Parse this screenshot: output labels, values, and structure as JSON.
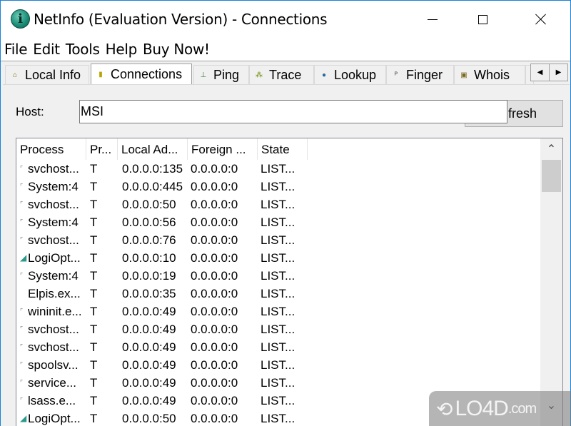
{
  "window": {
    "title": "NetInfo (Evaluation Version) - Connections",
    "app_icon_glyph": "i",
    "controls": {
      "minimize": "minimize-icon",
      "maximize": "maximize-icon",
      "close": "close-icon"
    }
  },
  "menu": [
    "File",
    "Edit",
    "Tools",
    "Help",
    "Buy Now!"
  ],
  "tabs": [
    {
      "label": "Local Info",
      "icon": "home-icon",
      "glyph": "⌂",
      "color": "#7a6a00",
      "active": false
    },
    {
      "label": "Connections",
      "icon": "connections-icon",
      "glyph": "▮",
      "color": "#b8a400",
      "active": true
    },
    {
      "label": "Ping",
      "icon": "ping-icon",
      "glyph": "⊥",
      "color": "#3a7a3a",
      "active": false
    },
    {
      "label": "Trace",
      "icon": "trace-icon",
      "glyph": "⁂",
      "color": "#6a8a00",
      "active": false
    },
    {
      "label": "Lookup",
      "icon": "lookup-icon",
      "glyph": "●",
      "color": "#2a6aa0",
      "active": false
    },
    {
      "label": "Finger",
      "icon": "finger-icon",
      "glyph": "ᴾ",
      "color": "#404040",
      "active": false
    },
    {
      "label": "Whois",
      "icon": "whois-icon",
      "glyph": "▣",
      "color": "#7a6a20",
      "active": false
    }
  ],
  "tab_scroll": {
    "left": "◀",
    "right": "▶"
  },
  "host": {
    "label": "Host:",
    "value": "MSI"
  },
  "refresh_button": {
    "label": "Refresh",
    "visible_label": "fresh"
  },
  "table": {
    "columns": [
      "Process",
      "Pr...",
      "Local Ad...",
      "Foreign ...",
      "State"
    ],
    "rows": [
      {
        "icon": "generic-process-icon",
        "process": "svchost...",
        "protocol": "T",
        "local": "0.0.0.0:135",
        "foreign": "0.0.0.0:0",
        "state": "LIST..."
      },
      {
        "icon": "generic-process-icon",
        "process": "System:4",
        "protocol": "T",
        "local": "0.0.0.0:445",
        "foreign": "0.0.0.0:0",
        "state": "LIST..."
      },
      {
        "icon": "generic-process-icon",
        "process": "svchost...",
        "protocol": "T",
        "local": "0.0.0.0:50",
        "foreign": "0.0.0.0:0",
        "state": "LIST..."
      },
      {
        "icon": "generic-process-icon",
        "process": "System:4",
        "protocol": "T",
        "local": "0.0.0.0:56",
        "foreign": "0.0.0.0:0",
        "state": "LIST..."
      },
      {
        "icon": "generic-process-icon",
        "process": "svchost...",
        "protocol": "T",
        "local": "0.0.0.0:76",
        "foreign": "0.0.0.0:0",
        "state": "LIST..."
      },
      {
        "icon": "logitech-icon",
        "process": "LogiOpt...",
        "protocol": "T",
        "local": "0.0.0.0:10",
        "foreign": "0.0.0.0:0",
        "state": "LIST..."
      },
      {
        "icon": "generic-process-icon",
        "process": "System:4",
        "protocol": "T",
        "local": "0.0.0.0:19",
        "foreign": "0.0.0.0:0",
        "state": "LIST..."
      },
      {
        "icon": "none",
        "process": "Elpis.ex...",
        "protocol": "T",
        "local": "0.0.0.0:35",
        "foreign": "0.0.0.0:0",
        "state": "LIST..."
      },
      {
        "icon": "generic-process-icon",
        "process": "wininit.e...",
        "protocol": "T",
        "local": "0.0.0.0:49",
        "foreign": "0.0.0.0:0",
        "state": "LIST..."
      },
      {
        "icon": "generic-process-icon",
        "process": "svchost...",
        "protocol": "T",
        "local": "0.0.0.0:49",
        "foreign": "0.0.0.0:0",
        "state": "LIST..."
      },
      {
        "icon": "generic-process-icon",
        "process": "svchost...",
        "protocol": "T",
        "local": "0.0.0.0:49",
        "foreign": "0.0.0.0:0",
        "state": "LIST..."
      },
      {
        "icon": "generic-process-icon",
        "process": "spoolsv...",
        "protocol": "T",
        "local": "0.0.0.0:49",
        "foreign": "0.0.0.0:0",
        "state": "LIST..."
      },
      {
        "icon": "generic-process-icon",
        "process": "service...",
        "protocol": "T",
        "local": "0.0.0.0:49",
        "foreign": "0.0.0.0:0",
        "state": "LIST..."
      },
      {
        "icon": "generic-process-icon",
        "process": "lsass.e...",
        "protocol": "T",
        "local": "0.0.0.0:49",
        "foreign": "0.0.0.0:0",
        "state": "LIST..."
      },
      {
        "icon": "logitech-icon",
        "process": "LogiOpt...",
        "protocol": "T",
        "local": "0.0.0.0:50",
        "foreign": "0.0.0.0:0",
        "state": "LIST..."
      }
    ]
  },
  "scrollbar": {
    "up": "⌃",
    "down": "⌄"
  },
  "watermark": {
    "logo": "⟲",
    "text": "LO4D",
    "suffix": ".com"
  }
}
